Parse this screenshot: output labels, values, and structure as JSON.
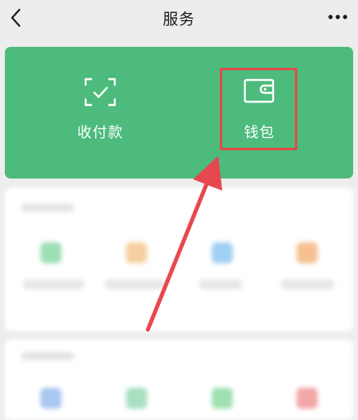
{
  "header": {
    "title": "服务",
    "back_icon": "chevron-left-icon",
    "more_icon": "more-dots-icon"
  },
  "card": {
    "background": "#4cbb7c",
    "items": [
      {
        "label": "收付款",
        "icon": "scan-check-icon"
      },
      {
        "label": "钱包",
        "icon": "wallet-icon"
      }
    ]
  },
  "annotation": {
    "highlight_color": "#e24a4a",
    "target": "钱包"
  }
}
